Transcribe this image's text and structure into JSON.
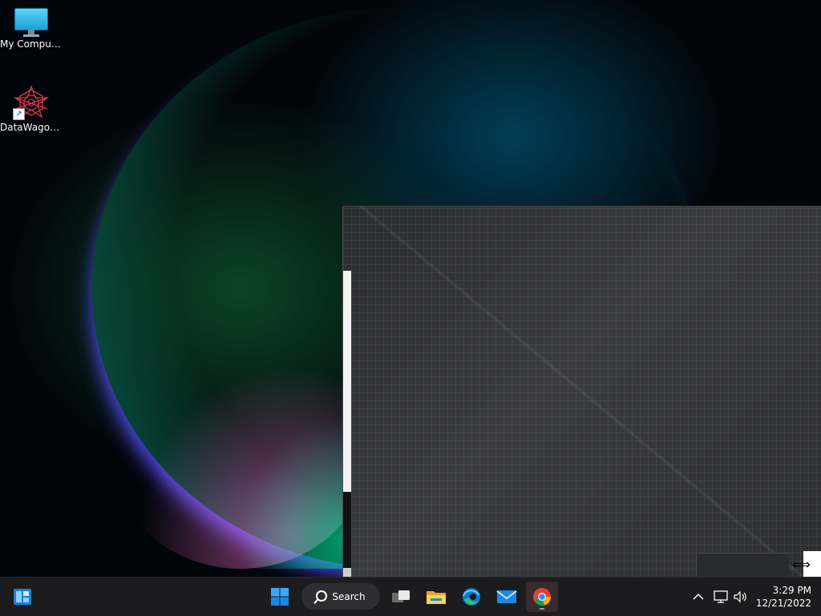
{
  "desktop": {
    "icons": [
      {
        "label": "My Computer",
        "icon": "monitor-icon"
      },
      {
        "label": "DataWagon...",
        "icon": "datawagon-app-icon"
      }
    ]
  },
  "taskbar": {
    "search_label": "Search",
    "pinned": [
      "widgets-icon",
      "start-icon",
      "task-view-icon",
      "file-explorer-icon",
      "edge-icon",
      "mail-icon",
      "chrome-icon"
    ],
    "active_app": "chrome-icon"
  },
  "tray": {
    "time": "3:29 PM",
    "date": "12/21/2022",
    "icons": [
      "chevron-up-icon",
      "network-icon",
      "volume-icon"
    ]
  },
  "colors": {
    "taskbar_bg": "#1c1c1e",
    "window_bg": "#2f3032",
    "accent_blue": "#1aa0d8"
  }
}
